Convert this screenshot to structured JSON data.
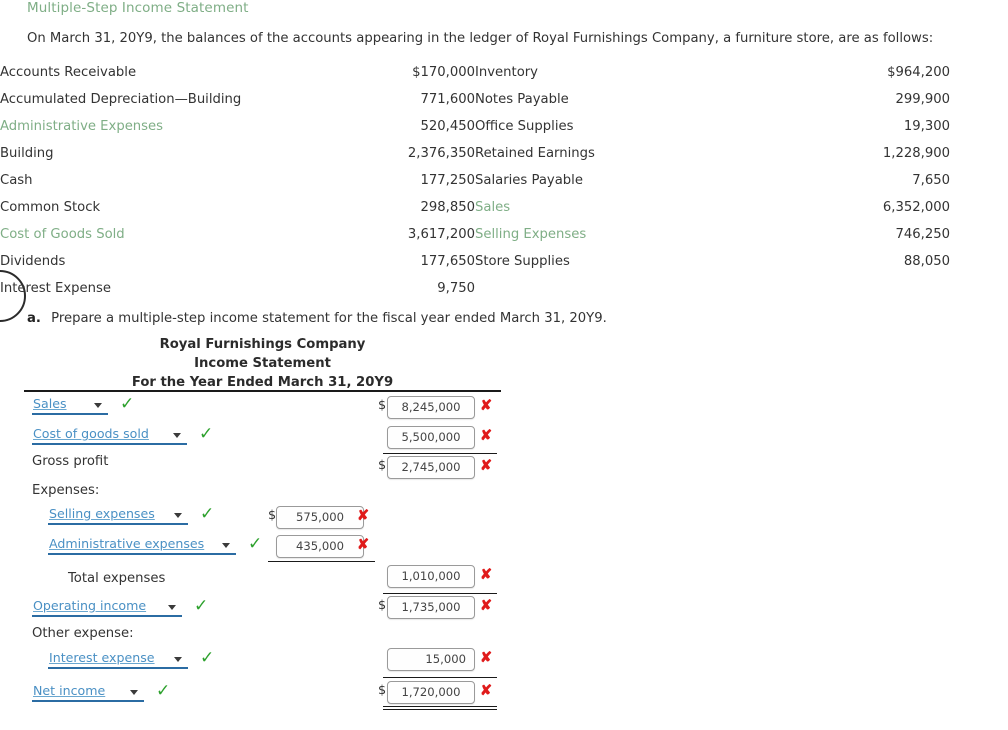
{
  "header": {
    "title": "Multiple-Step Income Statement",
    "intro": "On March 31, 20Y9, the balances of the accounts appearing in the ledger of Royal Furnishings Company, a furniture store, are as follows:"
  },
  "ledger": {
    "rows": [
      {
        "left_label": "Accounts Receivable",
        "left_value": "$170,000",
        "left_green": false,
        "right_label": "Inventory",
        "right_value": "$964,200",
        "right_green": false
      },
      {
        "left_label": "Accumulated Depreciation—Building",
        "left_value": "771,600",
        "left_green": false,
        "right_label": "Notes Payable",
        "right_value": "299,900",
        "right_green": false
      },
      {
        "left_label": "Administrative Expenses",
        "left_value": "520,450",
        "left_green": true,
        "right_label": "Office Supplies",
        "right_value": "19,300",
        "right_green": false
      },
      {
        "left_label": "Building",
        "left_value": "2,376,350",
        "left_green": false,
        "right_label": "Retained Earnings",
        "right_value": "1,228,900",
        "right_green": false
      },
      {
        "left_label": "Cash",
        "left_value": "177,250",
        "left_green": false,
        "right_label": "Salaries Payable",
        "right_value": "7,650",
        "right_green": false
      },
      {
        "left_label": "Common Stock",
        "left_value": "298,850",
        "left_green": false,
        "right_label": "Sales",
        "right_value": "6,352,000",
        "right_green": true
      },
      {
        "left_label": "Cost of Goods Sold",
        "left_value": "3,617,200",
        "left_green": true,
        "right_label": "Selling Expenses",
        "right_value": "746,250",
        "right_green": true
      },
      {
        "left_label": "Dividends",
        "left_value": "177,650",
        "left_green": false,
        "right_label": "Store Supplies",
        "right_value": "88,050",
        "right_green": false
      },
      {
        "left_label": "Interest Expense",
        "left_value": "9,750",
        "left_green": false,
        "right_label": "",
        "right_value": "",
        "right_green": false
      }
    ]
  },
  "question": {
    "marker": "a.",
    "text": "Prepare a multiple-step income statement for the fiscal year ended March 31, 20Y9."
  },
  "statement": {
    "company": "Royal Furnishings Company",
    "title": "Income Statement",
    "period": "For the Year Ended March 31, 20Y9"
  },
  "form": {
    "sales": {
      "option": "Sales",
      "amount": "8,245,000",
      "dollar": "$",
      "check": "✓",
      "x": "✘"
    },
    "cogs": {
      "option": "Cost of goods sold",
      "amount": "5,500,000",
      "check": "✓",
      "x": "✘"
    },
    "gross_profit": {
      "label": "Gross profit",
      "amount": "2,745,000",
      "dollar": "$",
      "x": "✘"
    },
    "expenses_label": "Expenses:",
    "selling": {
      "option": "Selling expenses",
      "amount": "575,000",
      "dollar": "$",
      "check": "✓",
      "x": "✘"
    },
    "admin": {
      "option": "Administrative expenses",
      "amount": "435,000",
      "check": "✓",
      "x": "✘"
    },
    "total_expenses": {
      "label": "Total expenses",
      "amount": "1,010,000",
      "x": "✘"
    },
    "operating_income": {
      "option": "Operating income",
      "amount": "1,735,000",
      "dollar": "$",
      "check": "✓",
      "x": "✘"
    },
    "other_expense_label": "Other expense:",
    "interest": {
      "option": "Interest expense",
      "amount": "15,000",
      "check": "✓",
      "x": "✘"
    },
    "net_income": {
      "option": "Net income",
      "amount": "1,720,000",
      "dollar": "$",
      "check": "✓",
      "x": "✘"
    }
  },
  "colors": {
    "accent_green": "#7fae86",
    "check_green": "#2da12d",
    "x_red": "#e01b1b",
    "select_blue": "#4a90c4",
    "select_underline": "#2b6ca3"
  }
}
